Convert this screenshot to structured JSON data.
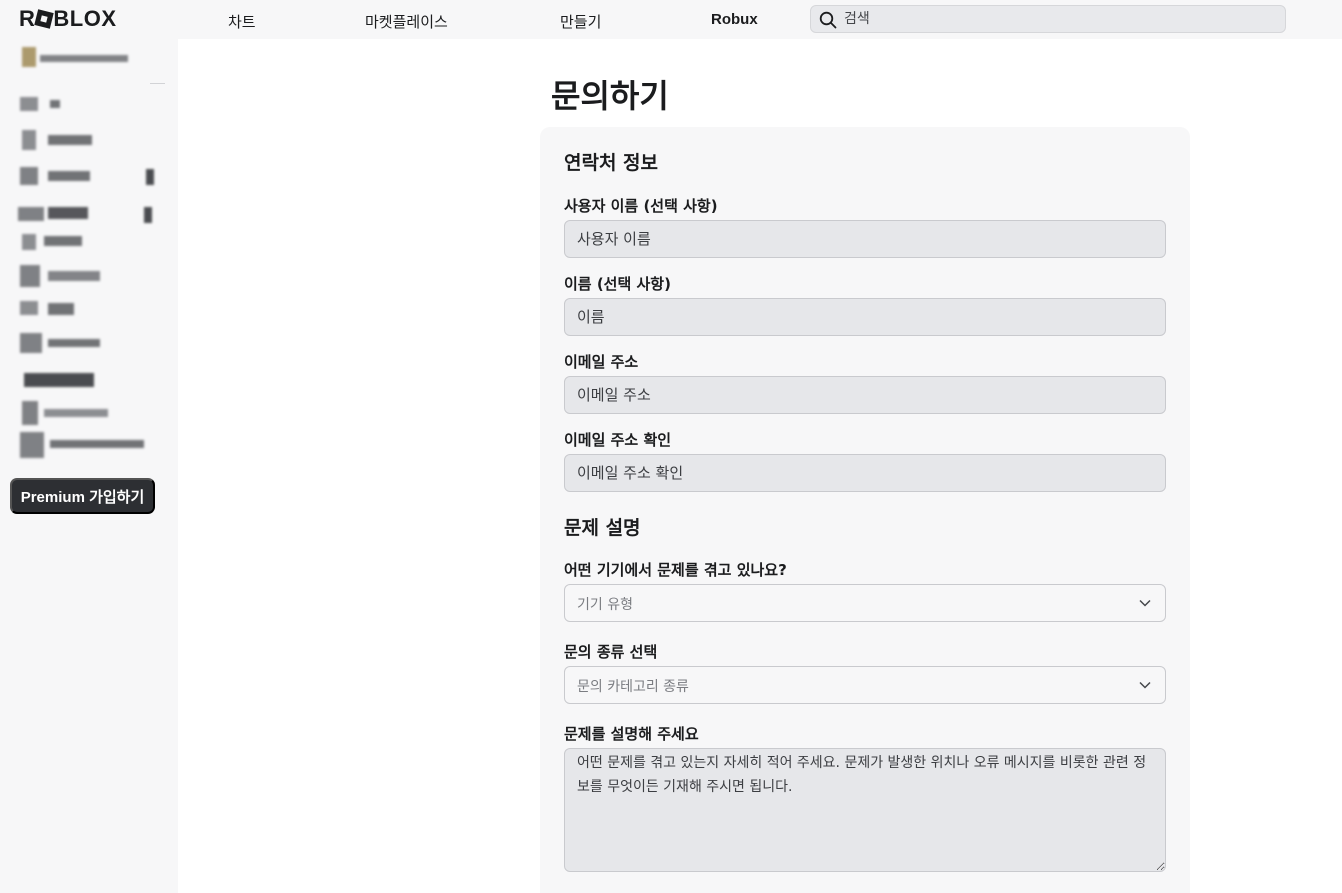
{
  "header": {
    "logo_text": [
      "R",
      "BLOX"
    ],
    "nav": {
      "charts": "차트",
      "marketplace": "마켓플레이스",
      "create": "만들기",
      "robux": "Robux"
    },
    "search": {
      "placeholder": "검색"
    }
  },
  "sidebar": {
    "premium_button": "Premium 가입하기"
  },
  "main": {
    "title": "문의하기",
    "contact_section": {
      "title": "연락처 정보",
      "username": {
        "label": "사용자 이름 (선택 사항)",
        "placeholder": "사용자 이름"
      },
      "name": {
        "label": "이름 (선택 사항)",
        "placeholder": "이름"
      },
      "email": {
        "label": "이메일 주소",
        "placeholder": "이메일 주소"
      },
      "email_confirm": {
        "label": "이메일 주소 확인",
        "placeholder": "이메일 주소 확인"
      }
    },
    "problem_section": {
      "title": "문제 설명",
      "device": {
        "label": "어떤 기기에서 문제를 겪고 있나요?",
        "selected": "기기 유형"
      },
      "category": {
        "label": "문의 종류 선택",
        "selected": "문의 카테고리 종류"
      },
      "description": {
        "label": "문제를 설명해 주세요",
        "placeholder": "어떤 문제를 겪고 있는지 자세히 적어 주세요. 문제가 발생한 위치나 오류 메시지를 비롯한 관련 정보를 무엇이든 기재해 주시면 됩니다."
      }
    }
  }
}
